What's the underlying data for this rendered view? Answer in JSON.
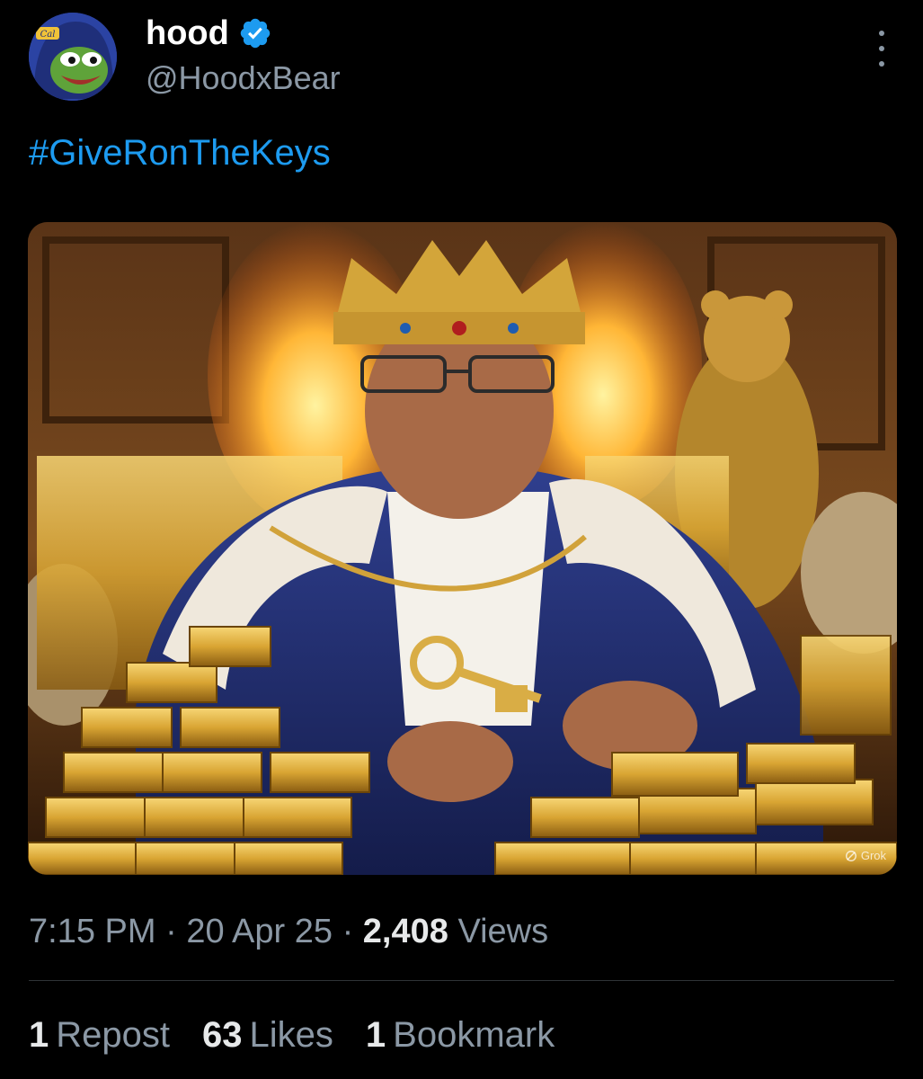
{
  "author": {
    "display_name": "hood",
    "handle": "@HoodxBear",
    "verified": true,
    "avatar_badge_text": "Cal"
  },
  "post": {
    "hashtag": "#GiveRonTheKeys",
    "media": {
      "watermark": "Grok"
    }
  },
  "meta": {
    "time": "7:15 PM",
    "separator": "·",
    "date": "20 Apr 25",
    "views_count": "2,408",
    "views_label": "Views"
  },
  "stats": {
    "reposts_count": "1",
    "reposts_label": "Repost",
    "likes_count": "63",
    "likes_label": "Likes",
    "bookmarks_count": "1",
    "bookmarks_label": "Bookmark"
  },
  "icons": {
    "verified": "verified-badge-icon",
    "more": "more-options-icon",
    "watermark": "grok-logo-icon"
  },
  "colors": {
    "background": "#000000",
    "text_primary": "#e7e9ea",
    "text_secondary": "#8b98a5",
    "link": "#1d9bf0",
    "verified": "#1d9bf0",
    "divider": "#2f3336"
  }
}
